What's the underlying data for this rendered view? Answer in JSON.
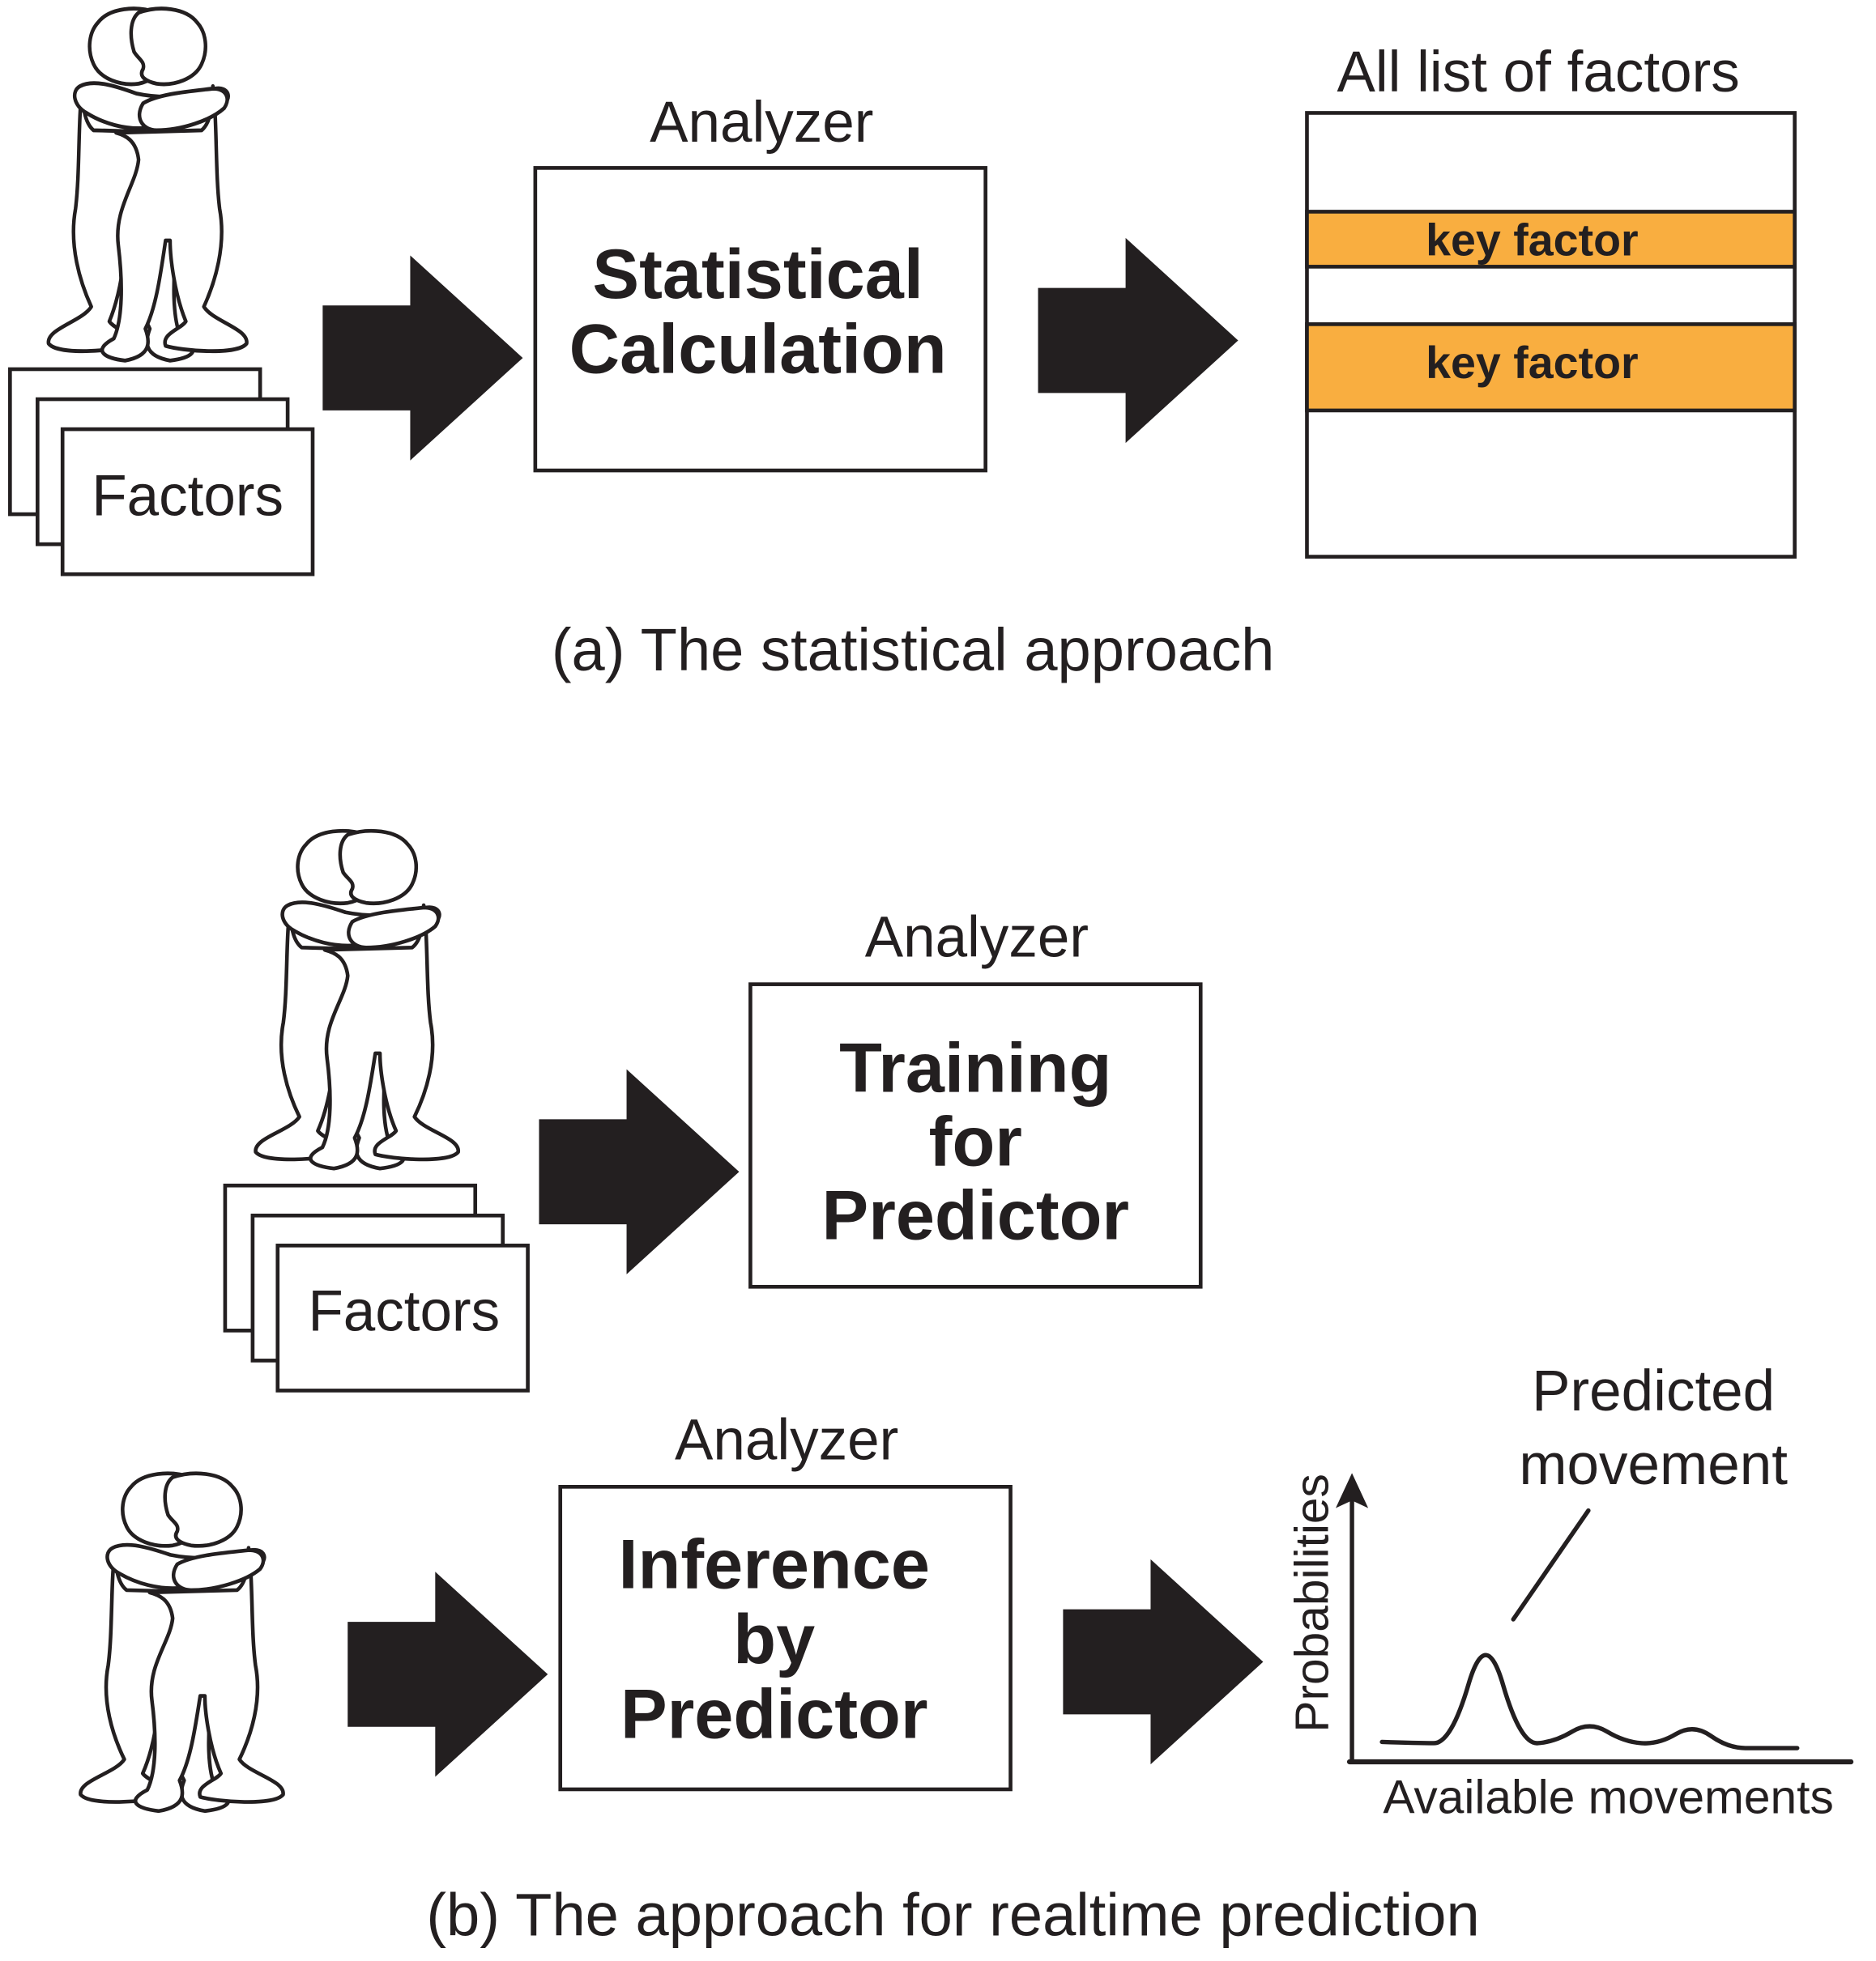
{
  "colors": {
    "ink": "#231f20",
    "key_factor_fill": "#f9ae40",
    "background": "#ffffff"
  },
  "panel_a": {
    "caption": "(a) The statistical approach",
    "factors_label": "Factors",
    "analyzer_label": "Analyzer",
    "analyzer_box": [
      "Statistical",
      "Calculation"
    ],
    "list_title": "All list of factors",
    "list_rows": [
      {
        "label": "",
        "highlight": false
      },
      {
        "label": "key factor",
        "highlight": true
      },
      {
        "label": "",
        "highlight": false
      },
      {
        "label": "key factor",
        "highlight": true
      },
      {
        "label": "",
        "highlight": false
      }
    ]
  },
  "panel_b": {
    "caption": "(b) The approach for realtime prediction",
    "training": {
      "factors_label": "Factors",
      "analyzer_label": "Analyzer",
      "analyzer_box": [
        "Training",
        "for",
        "Predictor"
      ]
    },
    "inference": {
      "analyzer_label": "Analyzer",
      "analyzer_box": [
        "Inference",
        "by",
        "Predictor"
      ]
    },
    "chart": {
      "annotation": [
        "Predicted",
        "movement"
      ],
      "ylabel": "Probabilities",
      "xlabel": "Available movements"
    }
  },
  "chart_data": {
    "type": "line",
    "title": "",
    "xlabel": "Available movements",
    "ylabel": "Probabilities",
    "annotations": [
      {
        "text": "Predicted movement",
        "target": "highest peak"
      }
    ],
    "series": [
      {
        "name": "probability",
        "x": [
          0,
          1,
          2,
          3,
          4,
          5,
          6,
          7,
          8,
          9,
          10,
          11,
          12
        ],
        "y": [
          0.05,
          0.04,
          0.04,
          1.0,
          0.03,
          0.05,
          0.22,
          0.05,
          0.03,
          0.2,
          0.0,
          0.0,
          0.0
        ]
      }
    ],
    "grid": false,
    "legend": "none"
  }
}
